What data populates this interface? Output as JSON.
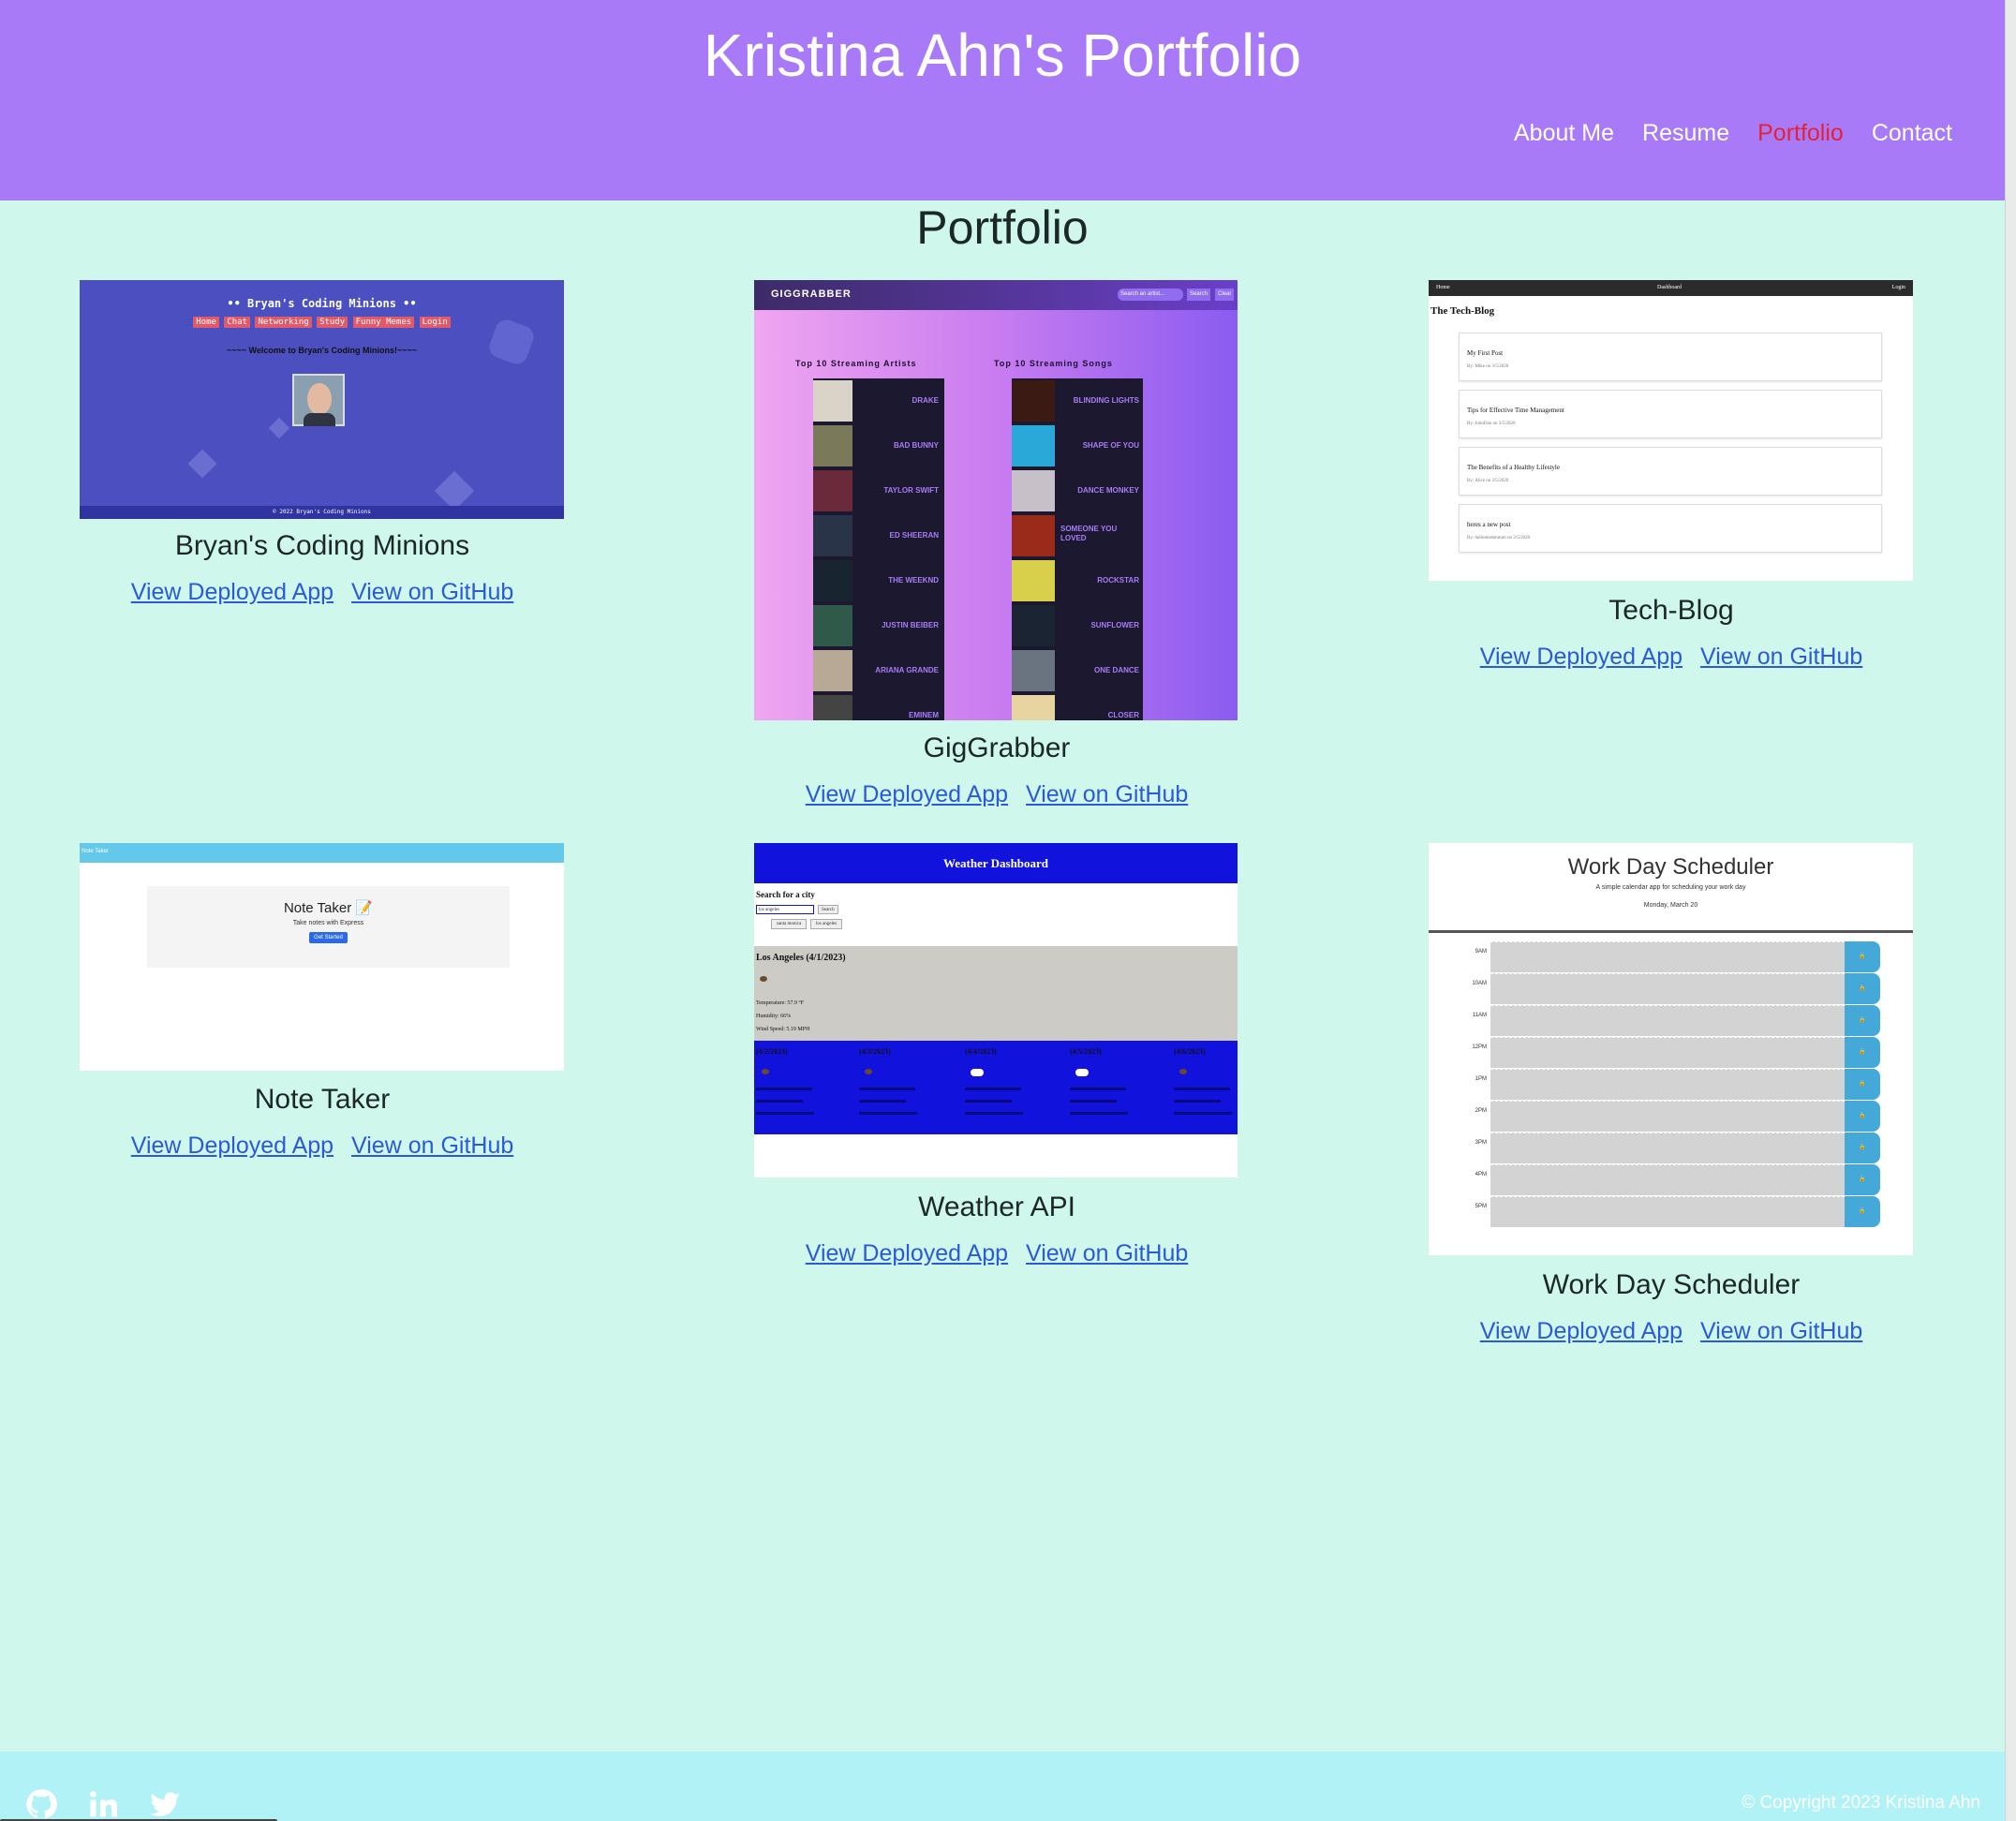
{
  "header": {
    "title": "Kristina Ahn's Portfolio",
    "nav": [
      "About Me",
      "Resume",
      "Portfolio",
      "Contact"
    ],
    "active_nav": "Portfolio"
  },
  "page_title": "Portfolio",
  "projects": [
    {
      "title": "Bryan's Coding Minions",
      "deployed_label": "View Deployed App",
      "github_label": "View on GitHub",
      "thumb": {
        "heading": "•• Bryan's Coding Minions ••",
        "nav": [
          "Home",
          "Chat",
          "Networking",
          "Study",
          "Funny Memes",
          "Login"
        ],
        "welcome": "~~~~ Welcome to Bryan's Coding Minions!~~~~",
        "footer": "© 2022 Bryan's Coding Minions"
      }
    },
    {
      "title": "GigGrabber",
      "deployed_label": "View Deployed App",
      "github_label": "View on GitHub",
      "thumb": {
        "brand": "GIGGRABBER",
        "search_placeholder": "Search an artist...",
        "search_btn": "Search",
        "clear_btn": "Clear",
        "artists_heading": "Top 10 Streaming Artists",
        "songs_heading": "Top 10 Streaming Songs",
        "artists": [
          "Drake",
          "Bad Bunny",
          "Taylor Swift",
          "Ed Sheeran",
          "The Weeknd",
          "Justin Beiber",
          "Ariana Grande",
          "Eminem"
        ],
        "songs": [
          "Blinding Lights",
          "Shape of You",
          "Dance Monkey",
          "Someone You Loved",
          "Rockstar",
          "Sunflower",
          "One Dance",
          "Closer"
        ]
      }
    },
    {
      "title": "Tech-Blog",
      "deployed_label": "View Deployed App",
      "github_label": "View on GitHub",
      "thumb": {
        "nav": [
          "Home",
          "Dashboard",
          "Login"
        ],
        "heading": "The Tech-Blog",
        "posts": [
          {
            "title": "My First Post",
            "meta": "By: Mike on 3/5/2020"
          },
          {
            "title": "Tips for Effective Time Management",
            "meta": "By: JohnDoe on 3/5/2020"
          },
          {
            "title": "The Benefits of a Healthy Lifestyle",
            "meta": "By: Alice on 3/5/2020"
          },
          {
            "title": "heres a new post",
            "meta": "By: hellomeetstutum on 3/5/2020"
          }
        ]
      }
    },
    {
      "title": "Note Taker",
      "deployed_label": "View Deployed App",
      "github_label": "View on GitHub",
      "thumb": {
        "nav": "Note Taker",
        "heading": "Note Taker 📝",
        "sub": "Take notes with Express",
        "button": "Get Started"
      }
    },
    {
      "title": "Weather API",
      "deployed_label": "View Deployed App",
      "github_label": "View on GitHub",
      "thumb": {
        "heading": "Weather Dashboard",
        "search_label": "Search for a city",
        "search_value": "los angeles",
        "search_btn": "Search",
        "history": [
          "santa monica",
          "los angeles"
        ],
        "current_city": "Los Angeles (4/1/2023)",
        "temp": "Temperature: 57.9 °F",
        "humidity": "Humidity: 66%",
        "wind": "Wind Speed: 5.19 MPH",
        "forecast": [
          "(4/2/2023)",
          "(4/3/2023)",
          "(4/4/2023)",
          "(4/5/2023)",
          "(4/6/2023)"
        ]
      }
    },
    {
      "title": "Work Day Scheduler",
      "deployed_label": "View Deployed App",
      "github_label": "View on GitHub",
      "thumb": {
        "heading": "Work Day Scheduler",
        "sub": "A simple calendar app for scheduling your work day",
        "date": "Monday, March 20",
        "hours": [
          "9AM",
          "10AM",
          "11AM",
          "12PM",
          "1PM",
          "2PM",
          "3PM",
          "4PM",
          "5PM"
        ]
      }
    }
  ],
  "footer": {
    "icons": [
      "github-icon",
      "linkedin-icon",
      "twitter-icon"
    ],
    "copyright": "© Copyright 2023 Kristina Ahn"
  },
  "colors": {
    "header_bg": "#a97af7",
    "page_bg": "#cff7eb",
    "footer_bg": "#b1f2f7",
    "link": "#2b5ad8",
    "active_nav": "#e3223a"
  }
}
